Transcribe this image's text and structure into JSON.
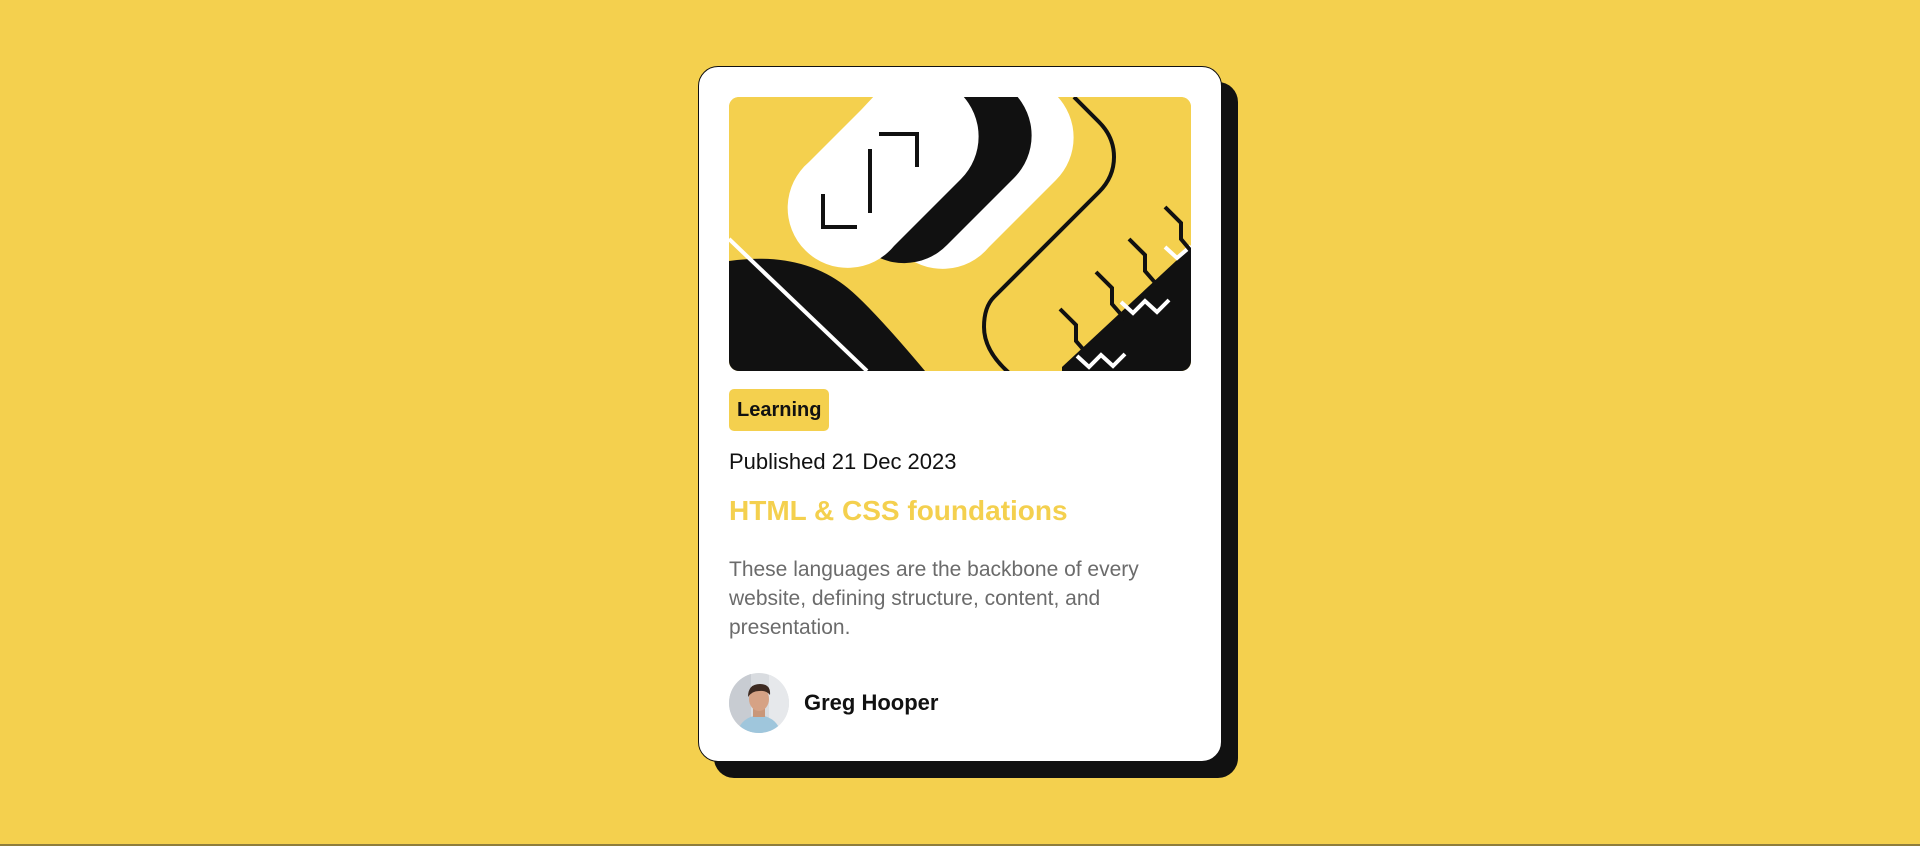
{
  "card": {
    "tag": "Learning",
    "published": "Published 21 Dec 2023",
    "title": "HTML & CSS foundations",
    "description": "These languages are the backbone of every website, defining structure, content, and presentation.",
    "author": {
      "name": "Greg Hooper"
    }
  },
  "icons": {
    "hero": "abstract-geometric-illustration",
    "avatar": "user-portrait"
  },
  "colors": {
    "background": "#f4d04e",
    "card": "#ffffff",
    "ink": "#111111",
    "accent": "#f4d04e",
    "muted": "#6b6b6b"
  }
}
